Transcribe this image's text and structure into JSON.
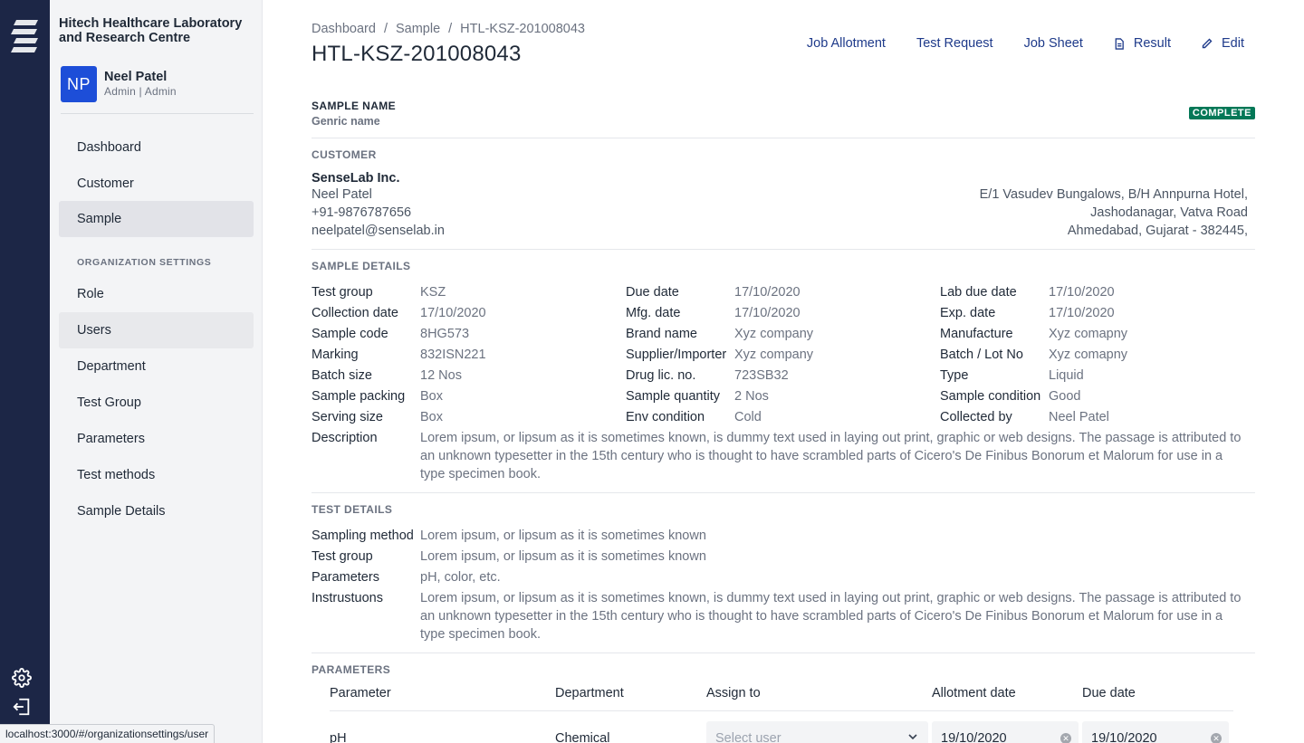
{
  "org": {
    "name": "Hitech Healthcare Laboratory and Research Centre"
  },
  "user": {
    "initials": "NP",
    "name": "Neel Patel",
    "role": "Admin | Admin"
  },
  "nav": {
    "items": [
      "Dashboard",
      "Customer",
      "Sample"
    ],
    "section_title": "ORGANIZATION SETTINGS",
    "settings_items": [
      "Role",
      "Users",
      "Department",
      "Test Group",
      "Parameters",
      "Test methods",
      "Sample Details"
    ],
    "active": "Sample",
    "hovered": "Users"
  },
  "status_url": "localhost:3000/#/organizationsettings/user",
  "breadcrumb": {
    "items": [
      "Dashboard",
      "Sample",
      "HTL-KSZ-201008043"
    ],
    "separator": "/"
  },
  "page_title": "HTL-KSZ-201008043",
  "actions": {
    "job_allotment": "Job Allotment",
    "test_request": "Test Request",
    "job_sheet": "Job Sheet",
    "result": "Result",
    "edit": "Edit"
  },
  "sample": {
    "label": "SAMPLE NAME",
    "value": "Genric name",
    "status": "COMPLETE",
    "status_color": "#047857"
  },
  "customer": {
    "title": "CUSTOMER",
    "company": "SenseLab Inc.",
    "contact": "Neel Patel",
    "phone": "+91-9876787656",
    "email": "neelpatel@senselab.in",
    "address": [
      "E/1 Vasudev Bungalows, B/H Annpurna Hotel,",
      "Jashodanagar, Vatva Road",
      "Ahmedabad, Gujarat - 382445,"
    ]
  },
  "sample_details": {
    "title": "SAMPLE DETAILS",
    "col1": [
      {
        "k": "Test group",
        "v": "KSZ"
      },
      {
        "k": "Collection date",
        "v": "17/10/2020"
      },
      {
        "k": "Sample code",
        "v": "8HG573"
      },
      {
        "k": "Marking",
        "v": "832ISN221"
      },
      {
        "k": "Batch size",
        "v": "12 Nos"
      },
      {
        "k": "Sample packing",
        "v": "Box"
      },
      {
        "k": "Serving size",
        "v": "Box"
      }
    ],
    "col2": [
      {
        "k": "Due date",
        "v": "17/10/2020"
      },
      {
        "k": "Mfg. date",
        "v": "17/10/2020"
      },
      {
        "k": "Brand name",
        "v": "Xyz company"
      },
      {
        "k": "Supplier/Importer",
        "v": "Xyz company"
      },
      {
        "k": "Drug lic. no.",
        "v": "723SB32"
      },
      {
        "k": "Sample quantity",
        "v": "2 Nos"
      },
      {
        "k": "Env condition",
        "v": "Cold"
      }
    ],
    "col3": [
      {
        "k": "Lab due date",
        "v": "17/10/2020"
      },
      {
        "k": "Exp. date",
        "v": "17/10/2020"
      },
      {
        "k": "Manufacture",
        "v": "Xyz comapny"
      },
      {
        "k": "Batch / Lot No",
        "v": "Xyz comapny"
      },
      {
        "k": "Type",
        "v": "Liquid"
      },
      {
        "k": "Sample condition",
        "v": "Good"
      },
      {
        "k": "Collected by",
        "v": "Neel Patel"
      }
    ],
    "description_label": "Description",
    "description": "Lorem ipsum, or lipsum as it is sometimes known, is dummy text used in laying out print, graphic or web designs. The passage is attributed to an unknown typesetter in the 15th century who is thought to have scrambled parts of Cicero's De Finibus Bonorum et Malorum for use in a type specimen book."
  },
  "test_details": {
    "title": "TEST DETAILS",
    "rows": [
      {
        "k": "Sampling method",
        "v": "Lorem ipsum, or lipsum as it is sometimes known"
      },
      {
        "k": "Test group",
        "v": "Lorem ipsum, or lipsum as it is sometimes known"
      },
      {
        "k": "Parameters",
        "v": "pH, color, etc."
      }
    ],
    "instructions_label": "Instrustuons",
    "instructions": "Lorem ipsum, or lipsum as it is sometimes known, is dummy text used in laying out print, graphic or web designs. The passage is attributed to an unknown typesetter in the 15th century who is thought to have scrambled parts of Cicero's De Finibus Bonorum et Malorum for use in a type specimen book."
  },
  "parameters": {
    "title": "PARAMETERS",
    "headers": [
      "Parameter",
      "Department",
      "Assign to",
      "Allotment date",
      "Due date"
    ],
    "rows": [
      {
        "parameter": "pH",
        "department": "Chemical",
        "assign_placeholder": "Select user",
        "allotment_date": "19/10/2020",
        "due_date": "19/10/2020"
      }
    ]
  },
  "icons": {
    "settings": "gear-icon",
    "logout": "logout-icon",
    "result": "document-icon",
    "edit": "pencil-icon"
  }
}
